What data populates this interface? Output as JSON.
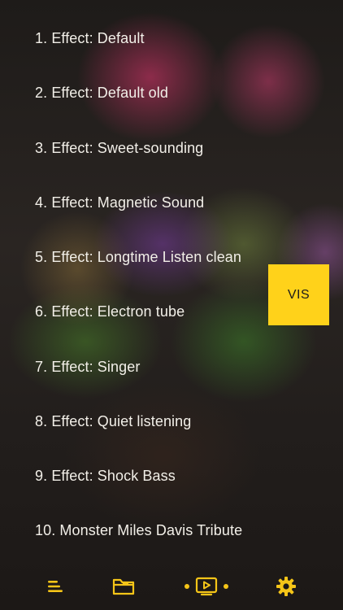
{
  "effects": [
    {
      "label": "1. Effect: Default"
    },
    {
      "label": "2. Effect: Default old"
    },
    {
      "label": "3. Effect: Sweet-sounding"
    },
    {
      "label": "4. Effect: Magnetic Sound"
    },
    {
      "label": "5. Effect: Longtime Listen clean"
    },
    {
      "label": "6. Effect: Electron tube"
    },
    {
      "label": "7. Effect: Singer"
    },
    {
      "label": "8. Effect: Quiet listening"
    },
    {
      "label": "9. Effect: Shock Bass"
    },
    {
      "label": "10. Monster Miles Davis Tribute"
    }
  ],
  "vis_button": {
    "label": "VIS"
  },
  "tabbar": {
    "items": [
      {
        "icon": "menu-lines-icon"
      },
      {
        "icon": "folder-icon"
      },
      {
        "icon": "play-screen-icon"
      },
      {
        "icon": "gear-icon"
      }
    ]
  },
  "colors": {
    "accent": "#ffd21a",
    "icon": "#f5c518",
    "text": "#f2efe8"
  }
}
